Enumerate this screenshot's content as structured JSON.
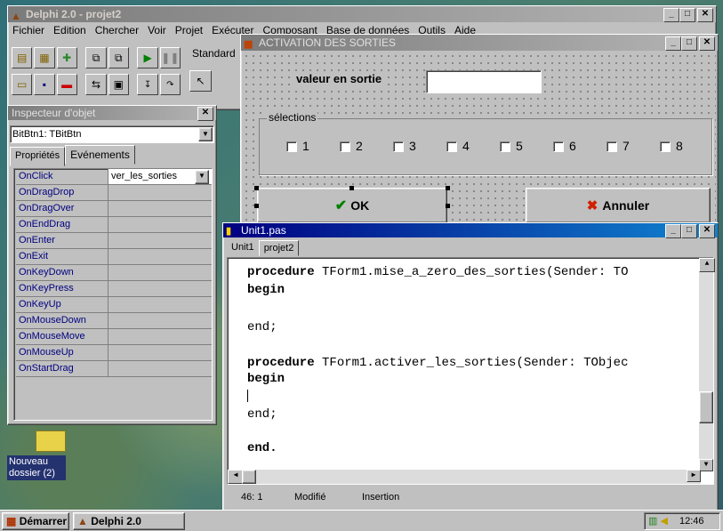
{
  "delphi": {
    "title": "Delphi 2.0 - projet2",
    "menu": [
      "Fichier",
      "Edition",
      "Chercher",
      "Voir",
      "Projet",
      "Exécuter",
      "Composant",
      "Base de données",
      "Outils",
      "Aide"
    ],
    "palette_tab": "Standard"
  },
  "form": {
    "title": "ACTIVATION DES SORTIES",
    "value_label": "valeur en sortie",
    "value_input": "",
    "group_label": "sélections",
    "checkboxes": [
      "1",
      "2",
      "3",
      "4",
      "5",
      "6",
      "7",
      "8"
    ],
    "ok_label": "OK",
    "cancel_label": "Annuler"
  },
  "inspector": {
    "title": "Inspecteur d'objet",
    "selector": "BitBtn1: TBitBtn",
    "tab_props": "Propriétés",
    "tab_events": "Evénements",
    "events": [
      {
        "name": "OnClick",
        "value": "ver_les_sorties"
      },
      {
        "name": "OnDragDrop",
        "value": ""
      },
      {
        "name": "OnDragOver",
        "value": ""
      },
      {
        "name": "OnEndDrag",
        "value": ""
      },
      {
        "name": "OnEnter",
        "value": ""
      },
      {
        "name": "OnExit",
        "value": ""
      },
      {
        "name": "OnKeyDown",
        "value": ""
      },
      {
        "name": "OnKeyPress",
        "value": ""
      },
      {
        "name": "OnKeyUp",
        "value": ""
      },
      {
        "name": "OnMouseDown",
        "value": ""
      },
      {
        "name": "OnMouseMove",
        "value": ""
      },
      {
        "name": "OnMouseUp",
        "value": ""
      },
      {
        "name": "OnStartDrag",
        "value": ""
      }
    ]
  },
  "editor": {
    "title": "Unit1.pas",
    "tabs": [
      "Unit1",
      "projet2"
    ],
    "line1_kw": "procedure",
    "line1_rest": " TForm1.mise_a_zero_des_sorties(Sender: TO",
    "begin": "begin",
    "end_semicolon": "end;",
    "line5_kw": "procedure",
    "line5_rest": " TForm1.activer_les_sorties(Sender: TObjec",
    "end_dot": "end.",
    "status_pos": "46: 1",
    "status_mod": "Modifié",
    "status_mode": "Insertion"
  },
  "desktop": {
    "folder_label_1": "Nouveau",
    "folder_label_2": "dossier (2)"
  },
  "taskbar": {
    "start_label": "Démarrer",
    "task_label": "Delphi 2.0",
    "clock": "12:46"
  }
}
